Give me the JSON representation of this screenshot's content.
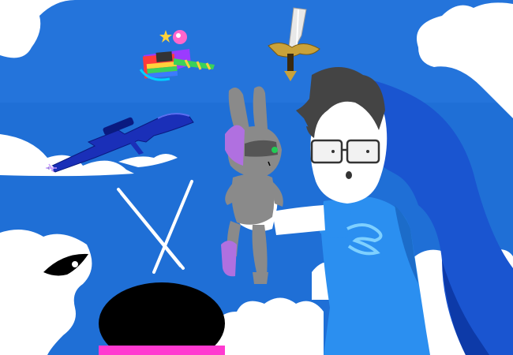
{
  "scene": {
    "kind": "fan-art illustration",
    "colors": {
      "sky": "#1f6fd6",
      "sky_light": "#3a8ae6",
      "cloud": "#ffffff",
      "hood": "#1a55d0",
      "hood_dark": "#0d3aa8",
      "shirt": "#2b8ff0",
      "shirt_dark": "#1c6cc9",
      "skin": "#ffffff",
      "hair": "#444444",
      "bunny_grey": "#8a8a8a",
      "bunny_purple": "#b070e0",
      "gold": "#c9a23a",
      "blade": "#e8e8e8",
      "rifle": "#1a2fb8",
      "hammer_rainbow": [
        "#ff3b3b",
        "#ffd23b",
        "#3bd15a",
        "#3b7bff",
        "#b33bff"
      ],
      "dark_figure": "#000000",
      "pink": "#ff3ad0"
    },
    "items": [
      "rainbow-hammer-icon",
      "legendary-sword-icon",
      "sniper-rifle-icon",
      "crossed-needles-icon",
      "bunny-plush",
      "character-with-hood",
      "shadowy-figure"
    ]
  }
}
